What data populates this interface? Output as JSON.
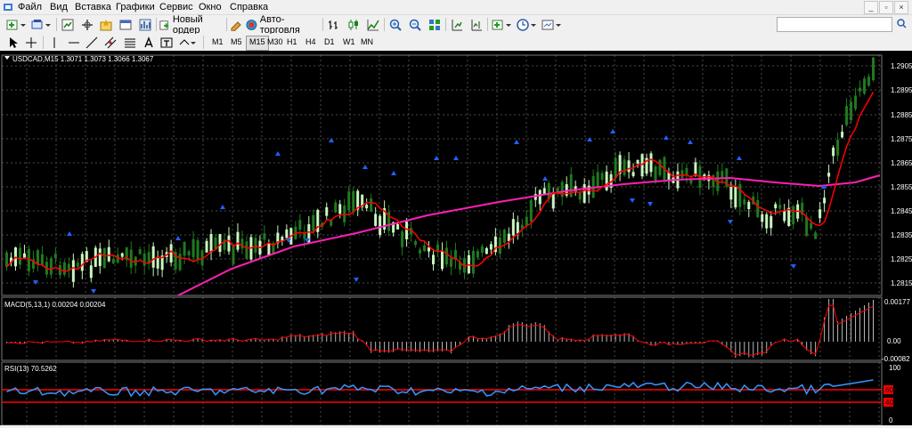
{
  "menu": [
    "Файл",
    "Вид",
    "Вставка",
    "Графики",
    "Сервис",
    "Окно",
    "Справка"
  ],
  "toolbar": {
    "new_order_label": "Новый ордер",
    "auto_trading_label": "Авто-торговля",
    "timeframes": [
      "M1",
      "M5",
      "M15",
      "M30",
      "H1",
      "H4",
      "D1",
      "W1",
      "MN"
    ],
    "active_timeframe": "M15"
  },
  "window_buttons": [
    "_",
    "▫",
    "×"
  ],
  "chart": {
    "header": "USDCAD,M15  1.3071 1.3073 1.3066 1.3067",
    "price_labels": [
      "1.2905",
      "1.2895",
      "1.2885",
      "1.2875",
      "1.2865",
      "1.2855",
      "1.2845",
      "1.2835",
      "1.2825",
      "1.2815"
    ],
    "macd_header": "MACD(5,13,1) 0.00204 0.00204",
    "macd_labels": [
      "0.00177",
      "0.00",
      "-0.00082"
    ],
    "rsi_header": "RSI(13) 70.5262",
    "rsi_labels": [
      "100",
      "60",
      "40",
      "0"
    ],
    "colors": {
      "background": "#000000",
      "grid": "#4a4a4a",
      "bull_candle": "#c8f7c0",
      "bear_candle": "#1f7a1f",
      "fast_ma": "#ff0000",
      "slow_ma": "#ff1fb4",
      "fractal_arrow": "#2060ff",
      "macd_histogram": "#b8b8b8",
      "macd_signal": "#ff0000",
      "rsi_line": "#3399ff",
      "rsi_levels": "#ff0000"
    }
  }
}
